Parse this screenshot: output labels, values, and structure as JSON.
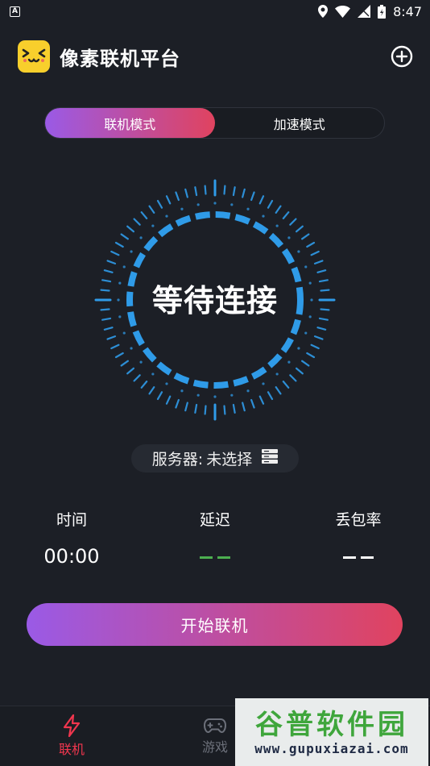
{
  "status_bar": {
    "notification_icon": "A",
    "time": "8:47"
  },
  "app_bar": {
    "title": "像素联机平台",
    "logo_icon": "pixel-face-icon",
    "add_icon": "plus-circle-icon"
  },
  "mode_toggle": {
    "tabs": [
      {
        "label": "联机模式",
        "active": true
      },
      {
        "label": "加速模式",
        "active": false
      }
    ]
  },
  "dial": {
    "status_text": "等待连接"
  },
  "server": {
    "label": "服务器:",
    "value": "未选择",
    "icon": "server-list-icon"
  },
  "stats": {
    "time": {
      "label": "时间",
      "value": "00:00"
    },
    "latency": {
      "label": "延迟",
      "value": "— —"
    },
    "loss": {
      "label": "丢包率",
      "value": "— —"
    }
  },
  "start_button": {
    "label": "开始联机"
  },
  "bottom_nav": {
    "items": [
      {
        "label": "联机",
        "icon": "lightning-icon",
        "active": true
      },
      {
        "label": "游戏",
        "icon": "gamepad-icon",
        "active": false
      }
    ]
  },
  "watermark": {
    "main": "谷普软件园",
    "sub": "www.gupuxiazai.com"
  },
  "colors": {
    "accent_start": "#9a5ae6",
    "accent_end": "#e0435f",
    "dial_blue": "#2f9be8",
    "latency_dash": "#4caf50",
    "nav_active": "#f0364e"
  }
}
